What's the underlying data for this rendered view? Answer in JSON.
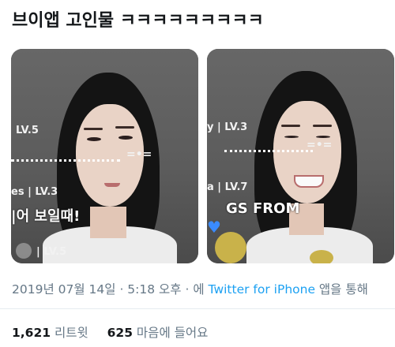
{
  "tweet": {
    "text": "브이앱 고인물 ㅋㅋㅋㅋㅋㅋㅋㅋㅋ"
  },
  "media": {
    "left": {
      "overlay_top": "LV.5",
      "overlay_mid": "es | LV.3",
      "overlay_subtitle": "|어 보일때!",
      "overlay_bottom": "| LV.5",
      "face_marker": "=•="
    },
    "right": {
      "overlay_top": "y | LV.3",
      "overlay_mid": "a | LV.7",
      "overlay_subtitle": "GS FROM",
      "face_marker": "=•=",
      "heart_icon": "blue-heart-icon"
    }
  },
  "meta": {
    "datetime": "2019년 07월 14일 · 5:18 오후 · 에",
    "source_link": "Twitter for iPhone",
    "suffix": "앱을 통해"
  },
  "stats": {
    "retweets_count": "1,621",
    "retweets_label": "리트윗",
    "likes_count": "625",
    "likes_label": "마음에 들어요"
  },
  "colors": {
    "link": "#1da1f2",
    "meta_text": "#657786",
    "primary_text": "#14171a"
  }
}
